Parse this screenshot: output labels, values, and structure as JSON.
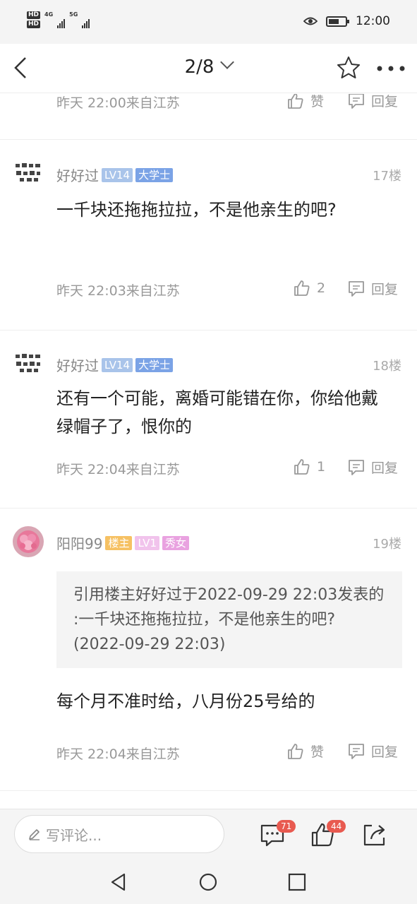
{
  "status_bar": {
    "sim1": "HD",
    "sim2": "HD",
    "net1": "4G",
    "net2": "5G",
    "time": "12:00"
  },
  "nav": {
    "page_indicator": "2/8",
    "icons": [
      "back-icon",
      "star-icon",
      "more-icon"
    ]
  },
  "partial_comment": {
    "meta": "昨天 22:00来自江苏",
    "like_label": "赞",
    "reply_label": "回复"
  },
  "comments": [
    {
      "username": "好好过",
      "level": "LV14",
      "degree": "大学士",
      "floor": "17楼",
      "text": "一千块还拖拖拉拉，不是他亲生的吧?",
      "meta": "昨天 22:03来自江苏",
      "likes": "2",
      "reply_label": "回复"
    },
    {
      "username": "好好过",
      "level": "LV14",
      "degree": "大学士",
      "floor": "18楼",
      "text": "还有一个可能，离婚可能错在你，你给他戴绿帽子了，恨你的",
      "meta": "昨天 22:04来自江苏",
      "likes": "1",
      "reply_label": "回复"
    },
    {
      "username": "阳阳99",
      "owner_badge": "楼主",
      "level": "LV1",
      "gender_badge": "秀女",
      "floor": "19楼",
      "quote": "引用楼主好好过于2022-09-29 22:03发表的 :一千块还拖拖拉拉，不是他亲生的吧? (2022-09-29 22:03)",
      "text": "每个月不准时给，八月份25号给的",
      "meta": "昨天 22:04来自江苏",
      "like_label": "赞",
      "reply_label": "回复"
    }
  ],
  "bottom_bar": {
    "comment_placeholder": "写评论...",
    "comment_count": "71",
    "like_count": "44"
  },
  "colors": {
    "badge_level": "#a9c4ea",
    "badge_degree": "#7ba3e6",
    "badge_owner": "#f6c163",
    "badge_red": "#e85a50"
  }
}
